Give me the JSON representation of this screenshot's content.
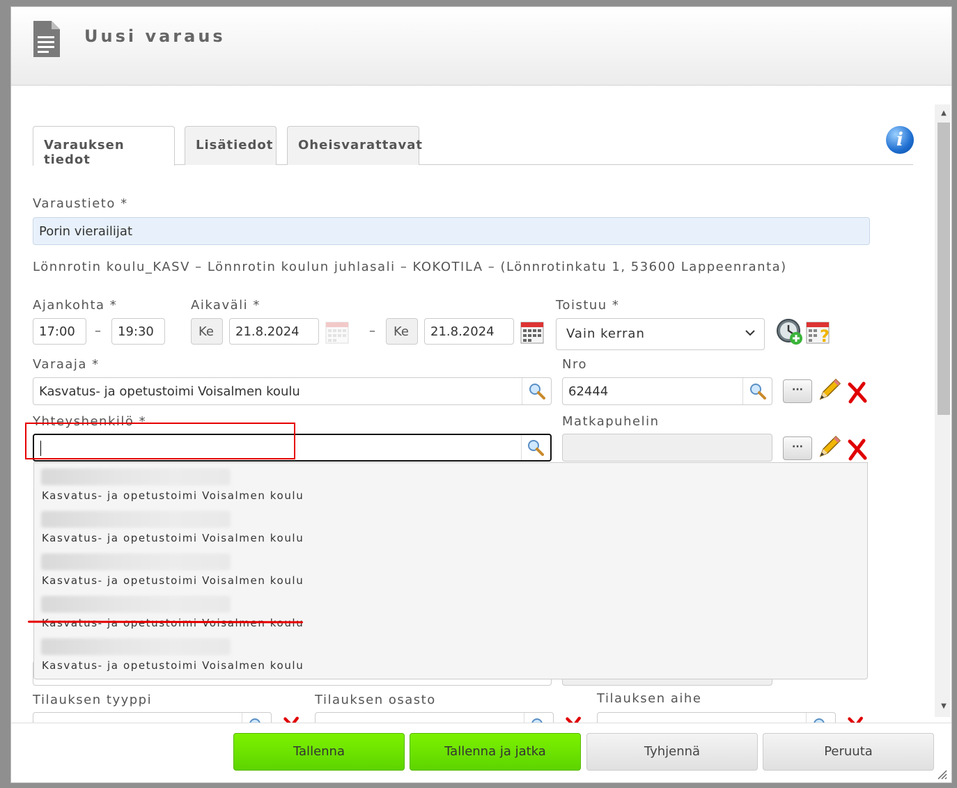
{
  "dialog": {
    "title": "Uusi varaus"
  },
  "tabs": [
    {
      "label": "Varauksen tiedot",
      "active": true
    },
    {
      "label": "Lisätiedot",
      "active": false
    },
    {
      "label": "Oheisvarattavat",
      "active": false
    }
  ],
  "info_icon": "info-icon",
  "form": {
    "varaustieto": {
      "label": "Varaustieto *",
      "value": "Porin vierailijat"
    },
    "location": "Lönnrotin koulu_KASV – Lönnrotin koulun juhlasali – KOKOTILA – (Lönnrotinkatu 1, 53600 Lappeenranta)",
    "ajankohta": {
      "label": "Ajankohta *",
      "start": "17:00",
      "end": "19:30",
      "dash": "–"
    },
    "aikavali": {
      "label": "Aikaväli *",
      "start_day": "Ke",
      "start_date": "21.8.2024",
      "end_day": "Ke",
      "end_date": "21.8.2024",
      "dash": "–"
    },
    "toistuu": {
      "label": "Toistuu *",
      "value": "Vain kerran"
    },
    "varaaja": {
      "label": "Varaaja *",
      "value": "Kasvatus- ja opetustoimi Voisalmen koulu"
    },
    "nro": {
      "label": "Nro",
      "value": "62444"
    },
    "yhteyshenkilo": {
      "label": "Yhteyshenkilö *",
      "value": ""
    },
    "matkapuhelin": {
      "label": "Matkapuhelin",
      "value": ""
    },
    "more_button": "···",
    "tilauksen_tyyppi": {
      "label": "Tilauksen tyyppi"
    },
    "tilauksen_osasto": {
      "label": "Tilauksen osasto"
    },
    "tilauksen_aihe": {
      "label": "Tilauksen aihe"
    }
  },
  "dropdown": {
    "items": [
      {
        "subtitle": "Kasvatus- ja opetustoimi Voisalmen koulu"
      },
      {
        "subtitle": "Kasvatus- ja opetustoimi Voisalmen koulu"
      },
      {
        "subtitle": "Kasvatus- ja opetustoimi Voisalmen koulu"
      },
      {
        "subtitle": "Kasvatus- ja opetustoimi Voisalmen koulu"
      },
      {
        "subtitle": "Kasvatus- ja opetustoimi Voisalmen koulu"
      }
    ]
  },
  "footer": {
    "save": "Tallenna",
    "save_continue": "Tallenna ja jatka",
    "clear": "Tyhjennä",
    "cancel": "Peruuta"
  },
  "colors": {
    "green_button": "#6ee000",
    "annotation_red": "#e60000",
    "input_blue": "#e8f1fb"
  }
}
